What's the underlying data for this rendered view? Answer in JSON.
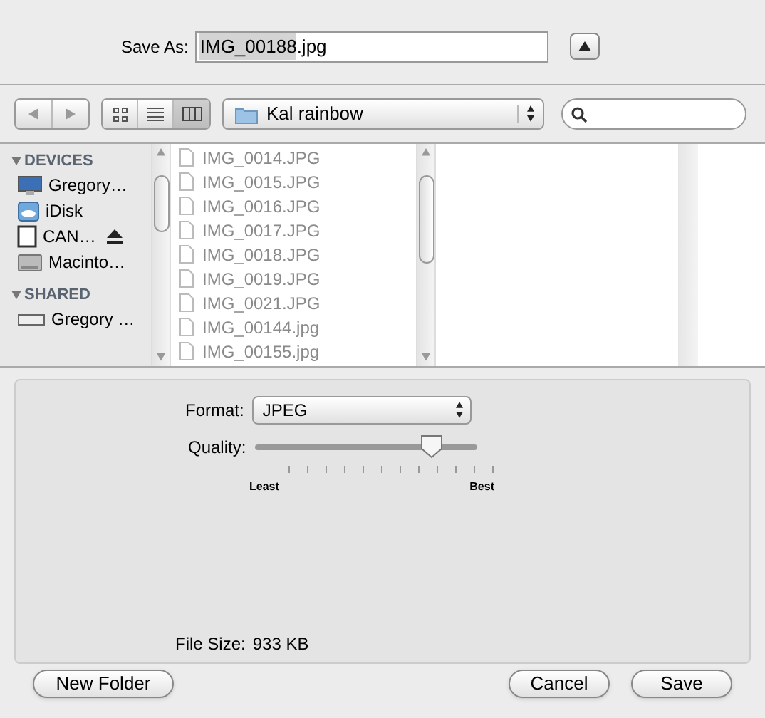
{
  "save_as": {
    "label": "Save As:",
    "selected_text": "IMG_00188",
    "unselected_text": ".jpg",
    "expanded": false
  },
  "toolbar": {
    "views": [
      {
        "kind": "icons",
        "selected": false
      },
      {
        "kind": "list",
        "selected": false
      },
      {
        "kind": "columns",
        "selected": true
      }
    ],
    "location": "Kal rainbow"
  },
  "sidebar": [
    {
      "heading": "DEVICES",
      "expanded": true,
      "items": [
        {
          "kind": "computer",
          "label": "Gregory…",
          "eject": false
        },
        {
          "kind": "idisk",
          "label": "iDisk",
          "eject": false
        },
        {
          "kind": "card",
          "label": "CAN…",
          "eject": true
        },
        {
          "kind": "disk",
          "label": "Macinto…",
          "eject": false
        }
      ]
    },
    {
      "heading": "SHARED",
      "expanded": true,
      "items": [
        {
          "kind": "network",
          "label": "Gregory …",
          "eject": false
        }
      ]
    }
  ],
  "files": [
    {
      "name": "IMG_0014.JPG",
      "disabled": true
    },
    {
      "name": "IMG_0015.JPG",
      "disabled": true
    },
    {
      "name": "IMG_0016.JPG",
      "disabled": true
    },
    {
      "name": "IMG_0017.JPG",
      "disabled": true
    },
    {
      "name": "IMG_0018.JPG",
      "disabled": true
    },
    {
      "name": "IMG_0019.JPG",
      "disabled": true
    },
    {
      "name": "IMG_0021.JPG",
      "disabled": true
    },
    {
      "name": "IMG_00144.jpg",
      "disabled": true
    },
    {
      "name": "IMG_00155.jpg",
      "disabled": true
    }
  ],
  "options": {
    "format_label": "Format:",
    "format": "JPEG",
    "quality_label": "Quality:",
    "quality": {
      "level": 0.8,
      "min_label": "Least",
      "max_label": "Best"
    },
    "file_size_label": "File Size:",
    "file_size": "933 KB"
  },
  "buttons": {
    "new_folder": "New Folder",
    "cancel": "Cancel",
    "save": "Save"
  }
}
